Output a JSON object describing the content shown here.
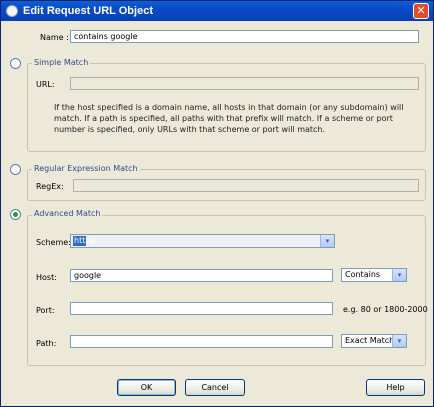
{
  "window": {
    "title": "Edit Request URL Object",
    "close_glyph": "✕"
  },
  "name": {
    "label": "Name :",
    "value": "contains google"
  },
  "simple_match": {
    "legend": "Simple Match",
    "url_label": "URL:",
    "url_value": "",
    "description": "If the host specified is a domain name, all hosts in that domain (or any subdomain) will match. If a path is specified, all paths with that prefix will match. If a scheme or port number is specified, only URLs with that scheme or port will match."
  },
  "regex_match": {
    "legend": "Regular Expression Match",
    "regex_label": "RegEx:",
    "regex_value": ""
  },
  "advanced_match": {
    "legend": "Advanced Match",
    "selected": true,
    "scheme_label": "Scheme:",
    "scheme_value": "https",
    "host_label": "Host:",
    "host_value": "google",
    "host_mode": "Contains",
    "port_label": "Port:",
    "port_value": "",
    "port_hint": "e.g. 80 or 1800-2000",
    "path_label": "Path:",
    "path_value": "",
    "path_mode": "Exact Match"
  },
  "buttons": {
    "ok": "OK",
    "cancel": "Cancel",
    "help": "Help"
  },
  "icons": {
    "dropdown": "▾"
  }
}
